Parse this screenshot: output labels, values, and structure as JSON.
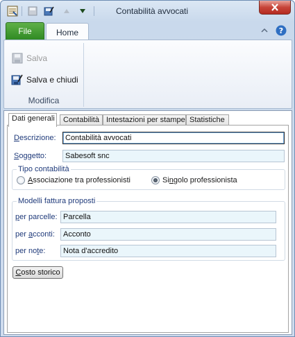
{
  "window": {
    "title": "Contabilità avvocati"
  },
  "qat": {
    "icons": [
      "app-icon",
      "save-icon",
      "save-close-icon",
      "up-arrow-icon",
      "down-arrow-icon"
    ]
  },
  "ribbon": {
    "file_label": "File",
    "home_label": "Home",
    "buttons": {
      "salva": "Salva",
      "salva_chiudi": "Salva e chiudi"
    },
    "group_label": "Modifica"
  },
  "tabs": [
    {
      "label": "Dati generali",
      "active": true
    },
    {
      "label": "Contabilità",
      "active": false
    },
    {
      "label": "Intestazioni per stampe",
      "active": false
    },
    {
      "label": "Statistiche",
      "active": false
    }
  ],
  "form": {
    "descrizione": {
      "label_u": "D",
      "label_rest": "escrizione:",
      "value": "Contabilità avvocati"
    },
    "soggetto": {
      "label_u": "S",
      "label_rest": "oggetto:",
      "value": "Sabesoft snc"
    },
    "tipo_contabilita": {
      "title": "Tipo contabilità",
      "option1": {
        "label_u": "A",
        "label_rest": "ssociazione tra professionisti",
        "checked": false
      },
      "option2": {
        "label_pre": "Si",
        "label_u": "n",
        "label_rest": "golo professionista",
        "checked": true
      }
    },
    "modelli": {
      "title": "Modelli fattura proposti",
      "parcelle": {
        "label_u": "p",
        "label_rest": "er parcelle:",
        "value": "Parcella"
      },
      "acconti": {
        "label_pre": "per ",
        "label_u": "a",
        "label_rest": "cconti:",
        "value": "Acconto"
      },
      "note": {
        "label_pre": "per no",
        "label_u": "t",
        "label_rest": "e:",
        "value": "Nota d'accredito"
      }
    },
    "costo_storico": {
      "label_u": "C",
      "label_rest": "osto storico"
    }
  },
  "colors": {
    "file_tab": "#2f8a23",
    "close_button": "#c7453a",
    "field_bg": "#eaf6fb",
    "label_text": "#1f3a7a"
  }
}
